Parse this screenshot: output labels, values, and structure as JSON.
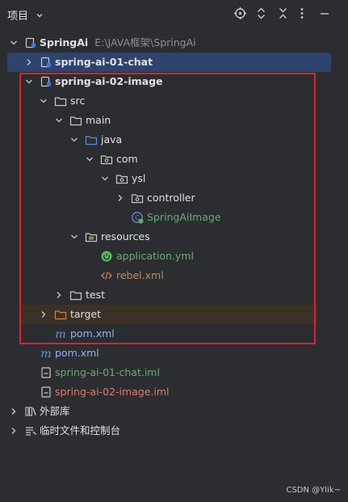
{
  "header": {
    "title": "项目"
  },
  "toolbar": [
    "locate-icon",
    "expand-collapse-icon",
    "collapse-all-icon",
    "more-icon",
    "minimize-icon"
  ],
  "tree": {
    "root": {
      "name": "SpringAi",
      "path": "E:\\JAVA框架\\SpringAi"
    },
    "module1": "spring-ai-01-chat",
    "module2": "spring-ai-02-image",
    "src": "src",
    "main": "main",
    "java": "java",
    "com": "com",
    "ysl": "ysl",
    "controller": "controller",
    "springAiImage": "SpringAiImage",
    "resources": "resources",
    "applicationYml": "application.yml",
    "rebelXml": "rebel.xml",
    "test": "test",
    "target": "target",
    "module2Pom": "pom.xml",
    "rootPom": "pom.xml",
    "chatIml": "spring-ai-01-chat.iml",
    "imageIml": "spring-ai-02-image.iml",
    "externalLibs": "外部库",
    "scratches": "临时文件和控制台"
  },
  "watermark": "CSDN @Ylik~",
  "colors": {
    "background": "#2b2d30",
    "selection": "#2e436e",
    "excluded": "#3b3125",
    "highlight_box": "#d9252a"
  }
}
